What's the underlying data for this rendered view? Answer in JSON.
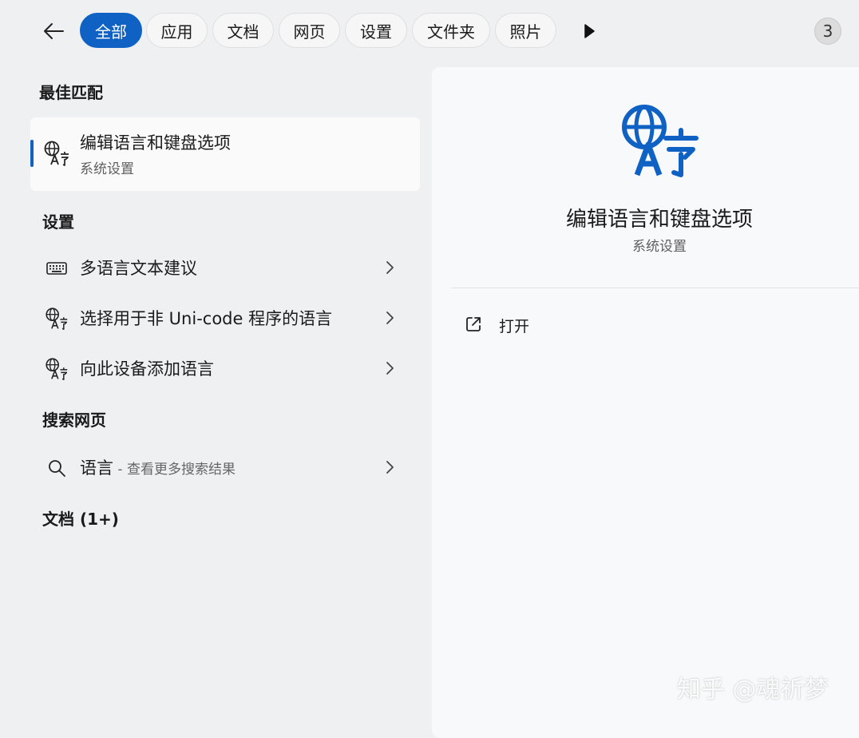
{
  "filters": {
    "tabs": [
      "全部",
      "应用",
      "文档",
      "网页",
      "设置",
      "文件夹",
      "照片"
    ],
    "active_index": 0,
    "more_count": "3"
  },
  "best_match": {
    "heading": "最佳匹配",
    "title": "编辑语言和键盘选项",
    "subtitle": "系统设置",
    "icon": "language-icon"
  },
  "settings": {
    "heading": "设置",
    "items": [
      {
        "label": "多语言文本建议",
        "icon": "keyboard-icon"
      },
      {
        "label": "选择用于非 Uni-code 程序的语言",
        "icon": "language-icon"
      },
      {
        "label": "向此设备添加语言",
        "icon": "language-icon"
      }
    ]
  },
  "web": {
    "heading": "搜索网页",
    "query": "语言",
    "hint": " - 查看更多搜索结果",
    "icon": "search-icon"
  },
  "documents": {
    "heading": "文档 (1+)"
  },
  "preview": {
    "title": "编辑语言和键盘选项",
    "subtitle": "系统设置",
    "icon": "language-icon",
    "action_label": "打开",
    "action_icon": "open-external-icon"
  },
  "watermark": "知乎 @魂祈梦",
  "colors": {
    "accent": "#0f62c4",
    "background": "#eff0f2"
  }
}
